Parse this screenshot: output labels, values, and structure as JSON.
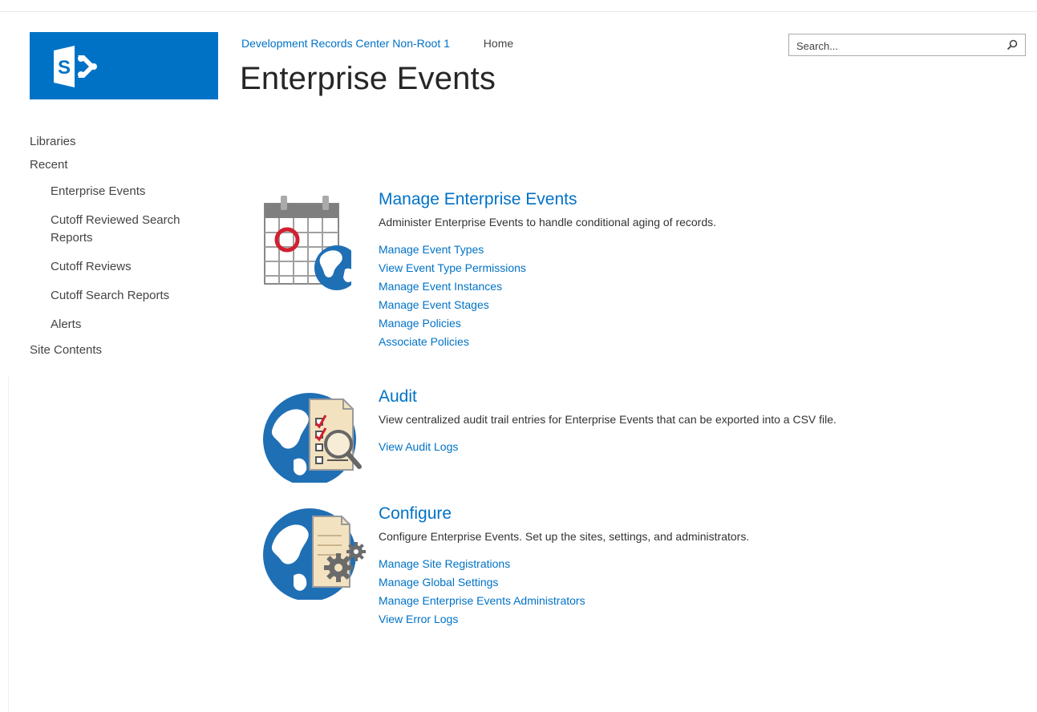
{
  "header": {
    "site_link": "Development Records Center Non-Root 1",
    "home_link": "Home",
    "page_title": "Enterprise Events"
  },
  "search": {
    "placeholder": "Search..."
  },
  "nav": {
    "libraries": "Libraries",
    "recent": "Recent",
    "recent_items": [
      "Enterprise Events",
      "Cutoff Reviewed Search Reports",
      "Cutoff Reviews",
      "Cutoff Search Reports",
      "Alerts"
    ],
    "site_contents": "Site Contents"
  },
  "sections": [
    {
      "title": "Manage Enterprise Events",
      "description": "Administer Enterprise Events to handle conditional aging of records.",
      "icon": "calendar-globe-icon",
      "links": [
        "Manage Event Types",
        "View Event Type Permissions",
        "Manage Event Instances",
        "Manage Event Stages",
        "Manage Policies",
        "Associate Policies"
      ]
    },
    {
      "title": "Audit",
      "description": "View centralized audit trail entries for Enterprise Events that can be exported into a CSV file.",
      "icon": "globe-audit-document-icon",
      "links": [
        "View Audit Logs"
      ]
    },
    {
      "title": "Configure",
      "description": "Configure Enterprise Events. Set up the sites, settings, and administrators.",
      "icon": "globe-settings-document-icon",
      "links": [
        "Manage Site Registrations",
        "Manage Global Settings",
        "Manage Enterprise Events Administrators",
        "View Error Logs"
      ]
    }
  ],
  "colors": {
    "brand": "#0072c6",
    "link": "#0072c6",
    "text": "#444444"
  }
}
